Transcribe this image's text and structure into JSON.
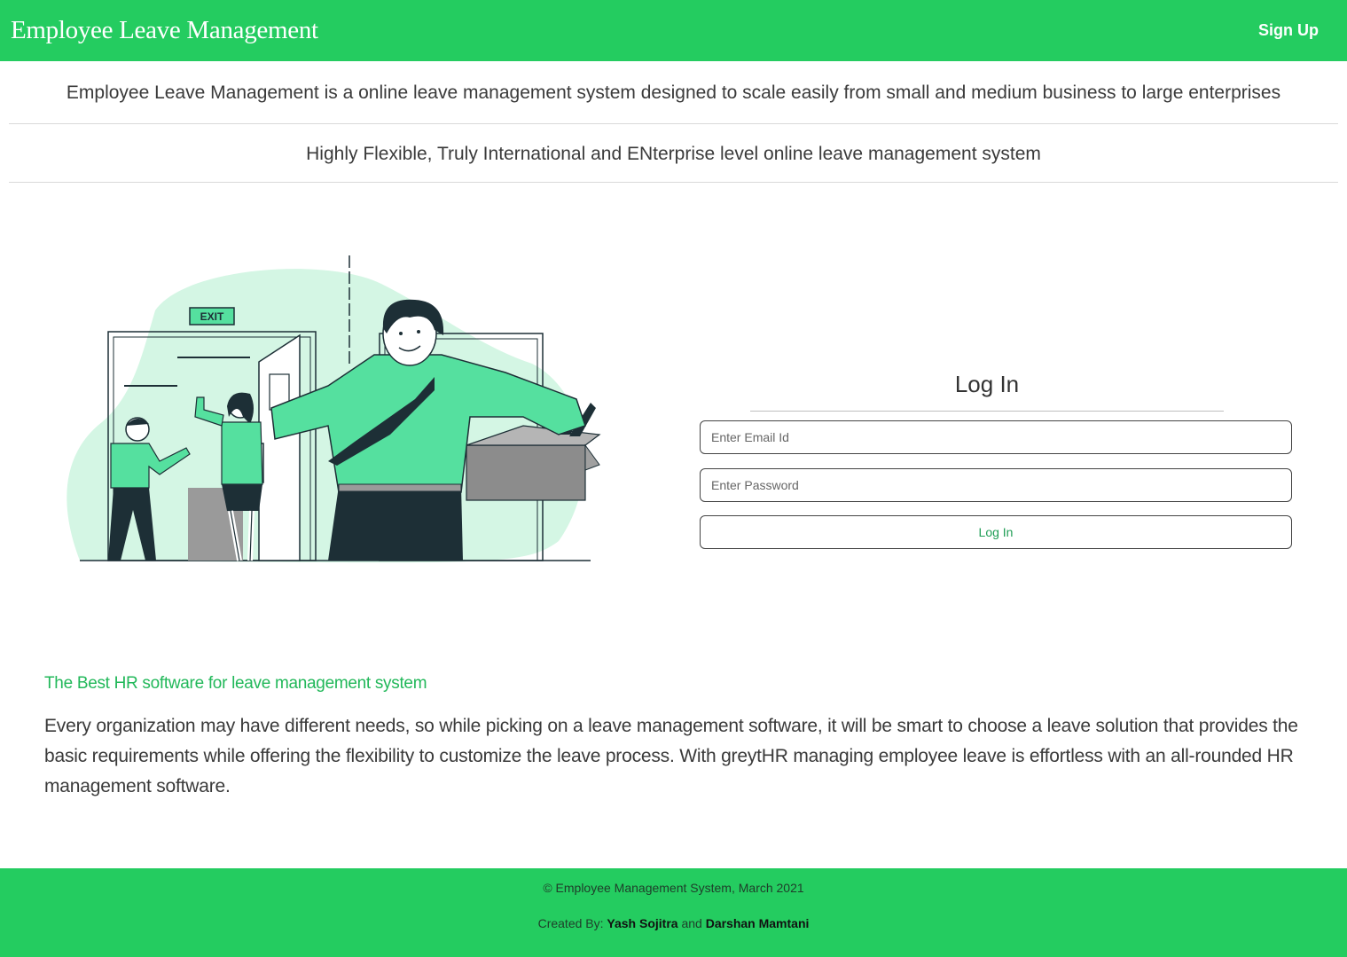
{
  "navbar": {
    "brand": "Employee Leave Management",
    "signup_label": "Sign Up"
  },
  "taglines": {
    "line1": "Employee Leave Management is a online leave management system designed to scale easily from small and medium business to large enterprises",
    "line2": "Highly Flexible, Truly International and ENterprise level online leave management system"
  },
  "illustration": {
    "exit_sign": "EXIT",
    "colors": {
      "accent": "#55e09f",
      "light": "#d4f6e4",
      "dark": "#1d2f36"
    }
  },
  "login": {
    "title": "Log In",
    "email_placeholder": "Enter Email Id",
    "email_value": "",
    "password_placeholder": "Enter Password",
    "password_value": "",
    "button_label": "Log In"
  },
  "info": {
    "heading": "The Best HR software for leave management system",
    "body": "Every organization may have different needs, so while picking on a leave management software, it will be smart to choose a leave solution that provides the basic requirements while offering the flexibility to customize the leave process. With greytHR managing employee leave is effortless with an all-rounded HR management software."
  },
  "footer": {
    "copyright": "© Employee Management System, March 2021",
    "created_by_label": "Created By:",
    "author1": "Yash Sojitra",
    "joiner": "and",
    "author2": "Darshan Mamtani"
  },
  "theme": {
    "primary": "#24cc60",
    "heading_green": "#22b85a"
  }
}
